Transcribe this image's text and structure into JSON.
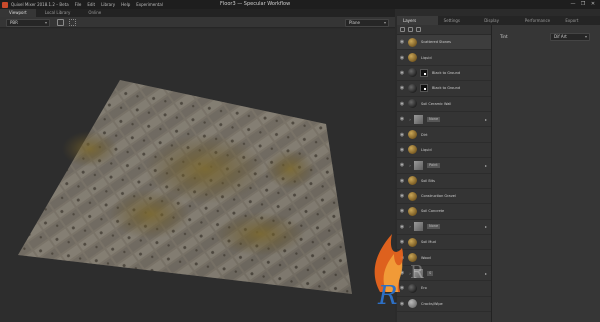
{
  "titlebar": {
    "menu": [
      "Quixel Mixer 2018.1.2 – Beta",
      "File",
      "Edit",
      "Library",
      "Help",
      "Experimental"
    ],
    "doc_title": "Floor3 — Specular Workflow",
    "controls": [
      "—",
      "❐",
      "✕"
    ]
  },
  "tabs": [
    "Viewport",
    "Local Library",
    "Online"
  ],
  "toolbar": {
    "channel": "PBR",
    "projection": "Plane"
  },
  "right_tabs": [
    "Layers",
    "Settings",
    "Display",
    "Performance",
    "Export"
  ],
  "layers": [
    {
      "name": "Scattered Stones",
      "thumb": "gold",
      "mask": false,
      "folder": false
    },
    {
      "name": "Liquid",
      "thumb": "gold",
      "mask": false,
      "folder": false
    },
    {
      "name": "Black to Ground",
      "thumb": "dark",
      "mask": true,
      "folder": false
    },
    {
      "name": "Black to Ground",
      "thumb": "dark",
      "mask": true,
      "folder": false
    },
    {
      "name": "Soil Ceramic Wall",
      "thumb": "dark",
      "mask": false,
      "folder": false
    },
    {
      "name": "None",
      "thumb": "grey",
      "mask": false,
      "folder": true
    },
    {
      "name": "Dirt",
      "thumb": "gold",
      "mask": false,
      "folder": false
    },
    {
      "name": "Liquid",
      "thumb": "gold",
      "mask": false,
      "folder": false
    },
    {
      "name": "Paint",
      "thumb": "grey",
      "mask": false,
      "folder": true
    },
    {
      "name": "Soil Bits",
      "thumb": "gold",
      "mask": false,
      "folder": false
    },
    {
      "name": "Construction Gravel",
      "thumb": "gold",
      "mask": false,
      "folder": false
    },
    {
      "name": "Soil Concrete",
      "thumb": "gold",
      "mask": false,
      "folder": false
    },
    {
      "name": "None",
      "thumb": "grey",
      "mask": false,
      "folder": true
    },
    {
      "name": "Soil Mud",
      "thumb": "gold",
      "mask": false,
      "folder": false
    },
    {
      "name": "Wood",
      "thumb": "gold",
      "mask": false,
      "folder": false
    },
    {
      "name": "S",
      "thumb": "grey",
      "mask": false,
      "folder": true
    },
    {
      "name": "Ero",
      "thumb": "dark",
      "mask": false,
      "folder": false
    },
    {
      "name": "Cracks/Wipe",
      "thumb": "grey",
      "mask": false,
      "folder": false
    }
  ],
  "props": {
    "label": "Tint",
    "value": "Dif Art"
  },
  "colors": {
    "accent_flame": "#e8641e",
    "accent_blue": "#2d6fc4"
  }
}
